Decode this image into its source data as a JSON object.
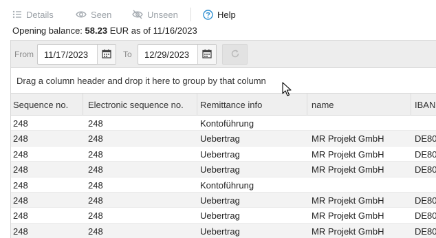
{
  "toolbar": {
    "details": "Details",
    "seen": "Seen",
    "unseen": "Unseen",
    "help": "Help"
  },
  "balance": {
    "label": "Opening balance:",
    "amount": "58.23",
    "rest": "EUR as of 11/16/2023"
  },
  "filter": {
    "from_label": "From",
    "from_value": "11/17/2023",
    "to_label": "To",
    "to_value": "12/29/2023"
  },
  "group_panel": "Drag a column header and drop it here to group by that column",
  "columns": [
    "Sequence no.",
    "Electronic sequence no.",
    "Remittance info",
    "name",
    "IBAN"
  ],
  "rows": [
    {
      "seq": "248",
      "eseq": "248",
      "info": "Kontoführung",
      "name": "",
      "iban": ""
    },
    {
      "seq": "248",
      "eseq": "248",
      "info": "Uebertrag",
      "name": "MR Projekt GmbH",
      "iban": "DE80"
    },
    {
      "seq": "248",
      "eseq": "248",
      "info": "Uebertrag",
      "name": "MR Projekt GmbH",
      "iban": "DE80"
    },
    {
      "seq": "248",
      "eseq": "248",
      "info": "Uebertrag",
      "name": "MR Projekt GmbH",
      "iban": "DE80"
    },
    {
      "seq": "248",
      "eseq": "248",
      "info": "Kontoführung",
      "name": "",
      "iban": ""
    },
    {
      "seq": "248",
      "eseq": "248",
      "info": "Uebertrag",
      "name": "MR Projekt GmbH",
      "iban": "DE80"
    },
    {
      "seq": "248",
      "eseq": "248",
      "info": "Uebertrag",
      "name": "MR Projekt GmbH",
      "iban": "DE80"
    },
    {
      "seq": "248",
      "eseq": "248",
      "info": "Uebertrag",
      "name": "MR Projekt GmbH",
      "iban": "DE80"
    }
  ]
}
